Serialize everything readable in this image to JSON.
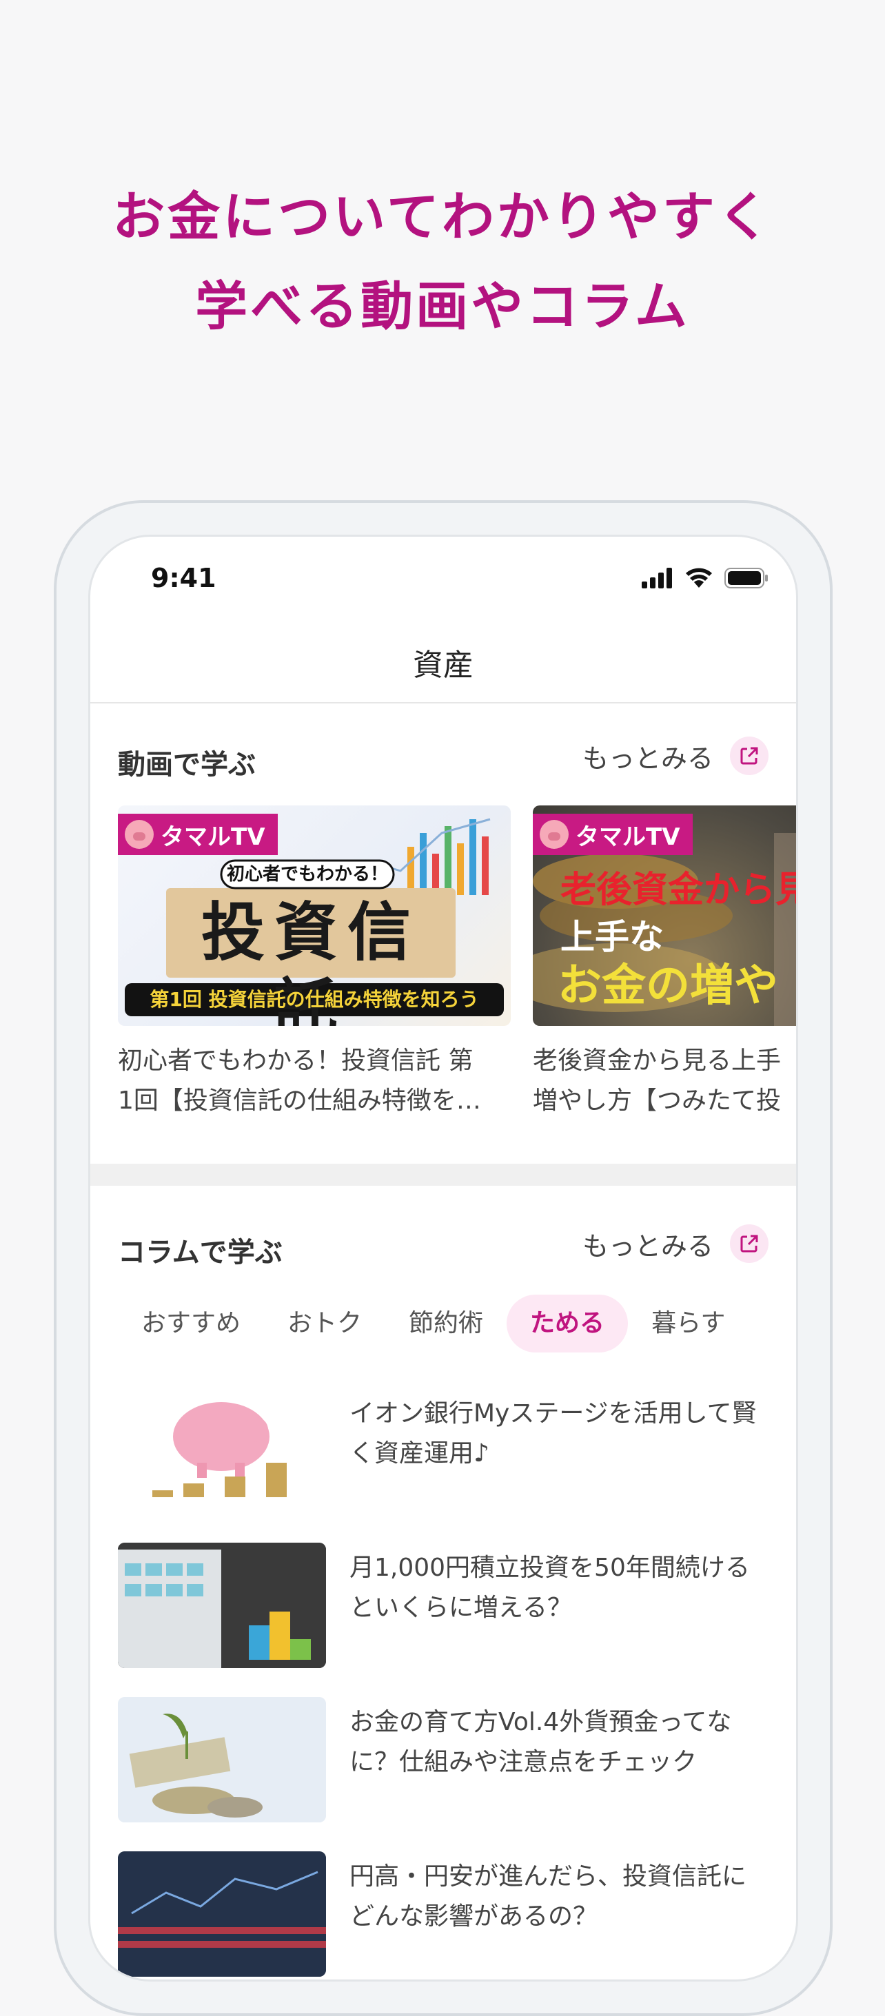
{
  "headline": {
    "line1": "お金についてわかりやすく",
    "line2": "学べる動画やコラム"
  },
  "status_bar": {
    "time": "9:41",
    "icons": [
      "signal-icon",
      "wifi-icon",
      "battery-icon"
    ]
  },
  "nav": {
    "title": "資産"
  },
  "video_section": {
    "title": "動画で学ぶ",
    "more_label": "もっとみる",
    "videos": [
      {
        "badge": "タマルTV",
        "thumb_tag": "初心者でもわかる！",
        "thumb_main": "投資信託",
        "thumb_footer": "第1回 投資信託の仕組み特徴を知ろう",
        "caption_line1": "初心者でもわかる！投資信託 第",
        "caption_line2": "1回【投資信託の仕組み特徴を…"
      },
      {
        "badge": "タマルTV",
        "thumb_line1": "老後資金から見",
        "thumb_line2": "上手な",
        "thumb_line3": "お金の増や",
        "caption_line1": "老後資金から見る上手",
        "caption_line2": "増やし方【つみたて投"
      }
    ]
  },
  "column_section": {
    "title": "コラムで学ぶ",
    "more_label": "もっとみる",
    "tabs": [
      "おすすめ",
      "おトク",
      "節約術",
      "ためる",
      "暮らす"
    ],
    "active_tab": "ためる",
    "articles": [
      {
        "title": "イオン銀行Myステージを活用して賢く資産運用♪"
      },
      {
        "title": "月1,000円積立投資を50年間続けるといくらに増える？"
      },
      {
        "title": "お金の育て方Vol.4外貨預金ってなに？仕組みや注意点をチェック"
      },
      {
        "title": "円高・円安が進んだら、投資信託にどんな影響があるの？"
      }
    ]
  },
  "colors": {
    "accent": "#b3127f",
    "active_tab_bg": "#fde8f4",
    "badge": "#c81a83"
  }
}
